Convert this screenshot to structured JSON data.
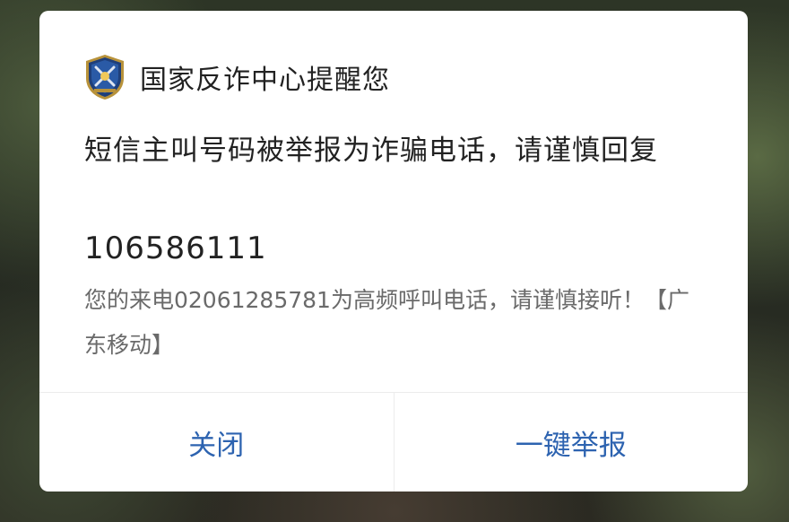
{
  "dialog": {
    "title": "国家反诈中心提醒您",
    "headline": "短信主叫号码被举报为诈骗电话，请谨慎回复",
    "number": "106586111",
    "detail": "您的来电02061285781为高频呼叫电话，请谨慎接听！【广东移动】",
    "badge_icon": "shield-badge-icon"
  },
  "buttons": {
    "close_label": "关闭",
    "report_label": "一键举报"
  },
  "colors": {
    "accent": "#2d63b0",
    "title_text": "#222222",
    "detail_text": "#6a6a6a",
    "badge_primary": "#1f3f7a",
    "badge_gold": "#b8923a"
  }
}
